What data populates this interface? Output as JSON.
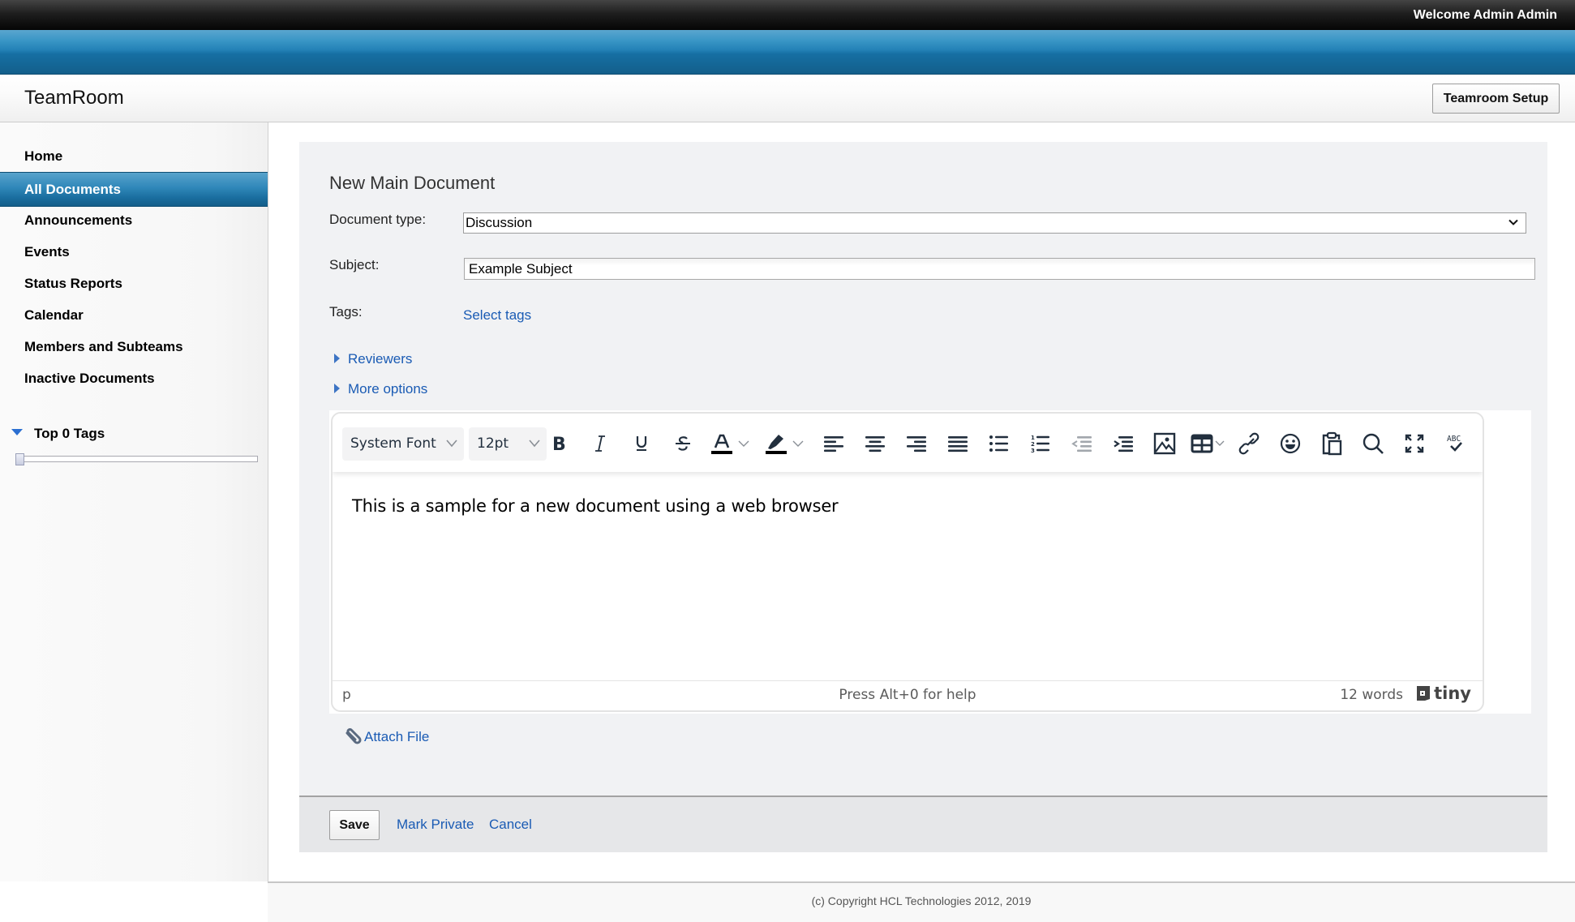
{
  "topbar": {
    "welcome": "Welcome Admin Admin"
  },
  "header": {
    "app_title": "TeamRoom",
    "setup_button": "Teamroom Setup"
  },
  "sidebar": {
    "items": [
      {
        "label": "Home",
        "active": false
      },
      {
        "label": "All Documents",
        "active": true
      },
      {
        "label": "Announcements",
        "active": false
      },
      {
        "label": "Events",
        "active": false
      },
      {
        "label": "Status Reports",
        "active": false
      },
      {
        "label": "Calendar",
        "active": false
      },
      {
        "label": "Members and Subteams",
        "active": false
      },
      {
        "label": "Inactive Documents",
        "active": false
      }
    ],
    "tags_heading": "Top 0 Tags",
    "tag_slider_value": 0
  },
  "form": {
    "title": "New Main Document",
    "document_type_label": "Document type:",
    "document_type_value": "Discussion",
    "subject_label": "Subject:",
    "subject_value": "Example Subject",
    "tags_label": "Tags:",
    "select_tags_link": "Select tags",
    "reviewers": "Reviewers",
    "more_options": "More options"
  },
  "editor": {
    "font_family": "System Font",
    "font_size": "12pt",
    "toolbar_icons": [
      "bold-icon",
      "italic-icon",
      "underline-icon",
      "strikethrough-icon",
      "text-color-icon",
      "highlight-color-icon",
      "align-left-icon",
      "align-center-icon",
      "align-right-icon",
      "align-justify-icon",
      "bullet-list-icon",
      "numbered-list-icon",
      "outdent-icon",
      "indent-icon",
      "image-icon",
      "table-icon",
      "link-icon",
      "emoji-icon",
      "paste-icon",
      "search-replace-icon",
      "fullscreen-icon",
      "spellcheck-icon"
    ],
    "text_color": "#000000",
    "highlight_color": "#000000",
    "content": "This is a sample for a new document using a web browser",
    "status_path": "p",
    "status_help": "Press Alt+0 for help",
    "word_count": "12 words",
    "brand": "tiny"
  },
  "attach_file": "Attach File",
  "actions": {
    "save": "Save",
    "mark_private": "Mark Private",
    "cancel": "Cancel"
  },
  "footer": {
    "copyright": "(c) Copyright HCL Technologies 2012, 2019"
  },
  "colors": {
    "link": "#1a5bb4",
    "accent_blue": "#1a6e9f",
    "panel_bg": "#f1f2f4"
  }
}
